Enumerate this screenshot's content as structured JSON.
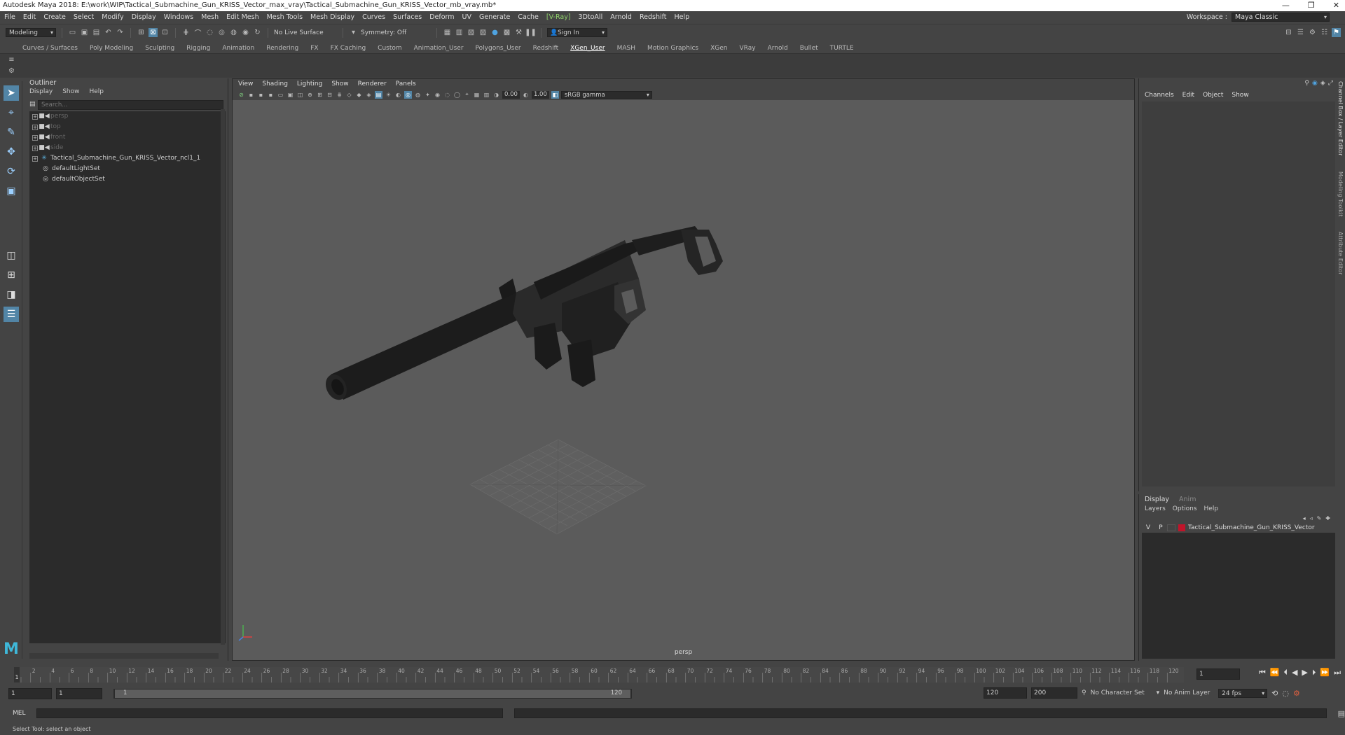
{
  "window": {
    "title": "Autodesk Maya 2018: E:\\work\\WIP\\Tactical_Submachine_Gun_KRISS_Vector_max_vray\\Tactical_Submachine_Gun_KRISS_Vector_mb_vray.mb*"
  },
  "menubar": {
    "items": [
      "File",
      "Edit",
      "Create",
      "Select",
      "Modify",
      "Display",
      "Windows",
      "Mesh",
      "Edit Mesh",
      "Mesh Tools",
      "Mesh Display",
      "Curves",
      "Surfaces",
      "Deform",
      "UV",
      "Generate",
      "Cache",
      "[V-Ray]",
      "3DtoAll",
      "Arnold",
      "Redshift",
      "Help"
    ],
    "workspace_label": "Workspace :",
    "workspace_value": "Maya Classic"
  },
  "statusline": {
    "mode": "Modeling",
    "live_surface": "No Live Surface",
    "symmetry": "Symmetry: Off",
    "sign_in": "Sign In"
  },
  "shelf": {
    "tabs": [
      "Curves / Surfaces",
      "Poly Modeling",
      "Sculpting",
      "Rigging",
      "Animation",
      "Rendering",
      "FX",
      "FX Caching",
      "Custom",
      "Animation_User",
      "Polygons_User",
      "Redshift",
      "XGen_User",
      "MASH",
      "Motion Graphics",
      "XGen",
      "VRay",
      "Arnold",
      "Bullet",
      "TURTLE"
    ],
    "active": "XGen_User"
  },
  "outliner": {
    "title": "Outliner",
    "menu": [
      "Display",
      "Show",
      "Help"
    ],
    "search_placeholder": "Search...",
    "items": [
      {
        "label": "persp",
        "type": "camera",
        "dim": true
      },
      {
        "label": "top",
        "type": "camera",
        "dim": true
      },
      {
        "label": "front",
        "type": "camera",
        "dim": true
      },
      {
        "label": "side",
        "type": "camera",
        "dim": true
      },
      {
        "label": "Tactical_Submachine_Gun_KRISS_Vector_ncl1_1",
        "type": "group",
        "dim": false
      },
      {
        "label": "defaultLightSet",
        "type": "set",
        "dim": false
      },
      {
        "label": "defaultObjectSet",
        "type": "set",
        "dim": false
      }
    ]
  },
  "viewport": {
    "menu": [
      "View",
      "Shading",
      "Lighting",
      "Show",
      "Renderer",
      "Panels"
    ],
    "exposure": "0.00",
    "gamma": "1.00",
    "color_space": "sRGB gamma",
    "camera_label": "persp"
  },
  "channelbox": {
    "menu": [
      "Channels",
      "Edit",
      "Object",
      "Show"
    ]
  },
  "layereditor": {
    "tabs": [
      "Display",
      "Anim"
    ],
    "menu": [
      "Layers",
      "Options",
      "Help"
    ],
    "layer": {
      "v": "V",
      "p": "P",
      "name": "Tactical_Submachine_Gun_KRISS_Vector",
      "color": "#c0142a"
    }
  },
  "sidetabs": [
    "Channel Box / Layer Editor",
    "Modeling Toolkit",
    "Attribute Editor"
  ],
  "timeline": {
    "tick_labels": [
      "2",
      "4",
      "6",
      "8",
      "10",
      "12",
      "14",
      "16",
      "18",
      "20",
      "22",
      "24",
      "26",
      "28",
      "30",
      "32",
      "34",
      "36",
      "38",
      "40",
      "42",
      "44",
      "46",
      "48",
      "50",
      "52",
      "54",
      "56",
      "58",
      "60",
      "62",
      "64",
      "66",
      "68",
      "70",
      "72",
      "74",
      "76",
      "78",
      "80",
      "82",
      "84",
      "86",
      "88",
      "90",
      "92",
      "94",
      "96",
      "98",
      "100",
      "102",
      "104",
      "106",
      "108",
      "110",
      "112",
      "114",
      "116",
      "118",
      "120"
    ],
    "current_frame_marker": "1",
    "current_frame_field": "1"
  },
  "range": {
    "start": "1",
    "start2": "1",
    "slider_start": "1",
    "slider_end": "120",
    "end": "120",
    "end2": "200",
    "character_set": "No Character Set",
    "anim_layer": "No Anim Layer",
    "fps": "24 fps"
  },
  "cmdline": {
    "label": "MEL"
  },
  "helpline": {
    "text": "Select Tool: select an object"
  }
}
